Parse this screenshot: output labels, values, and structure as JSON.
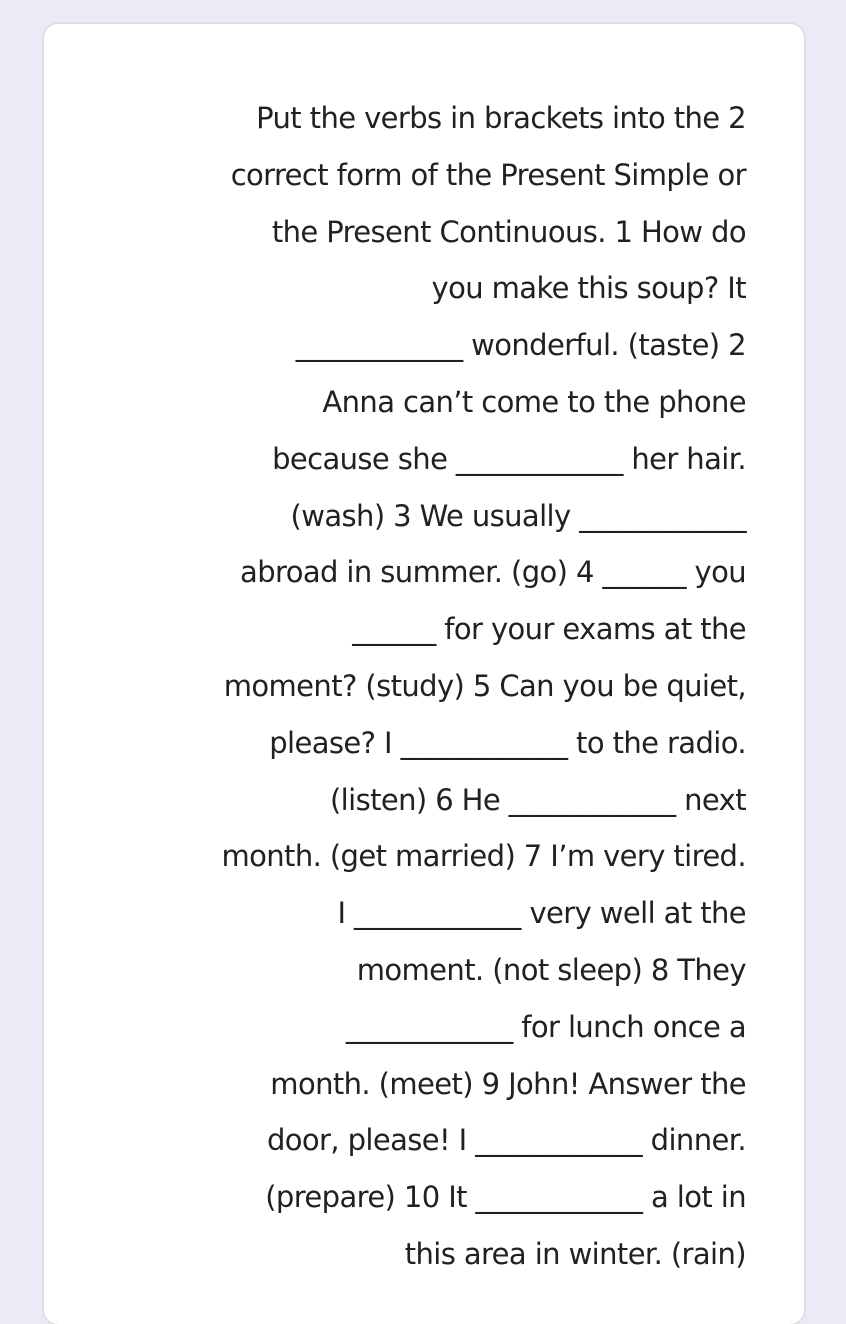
{
  "question": {
    "lines": [
      "Put the verbs in brackets into the 2",
      "correct form of the Present Simple or",
      "the Present Continuous. 1 How do",
      "you make this soup? It",
      "____________ wonderful. (taste) 2",
      "Anna can’t come to the phone",
      "because she ____________ her hair.",
      "(wash) 3 We usually ____________",
      "abroad in summer. (go) 4 ______ you",
      "______ for your exams at the",
      "moment? (study) 5 Can you be quiet,",
      "please? I ____________ to the radio.",
      "(listen) 6 He ____________ next",
      "month. (get married) 7 I’m very tired.",
      "I ____________ very well at the",
      "moment. (not sleep) 8 They",
      "____________ for lunch once a",
      "month. (meet) 9 John! Answer the",
      "door, please! I ____________ dinner.",
      "(prepare) 10 It ____________ a lot in",
      "this area in winter. (rain)"
    ]
  }
}
